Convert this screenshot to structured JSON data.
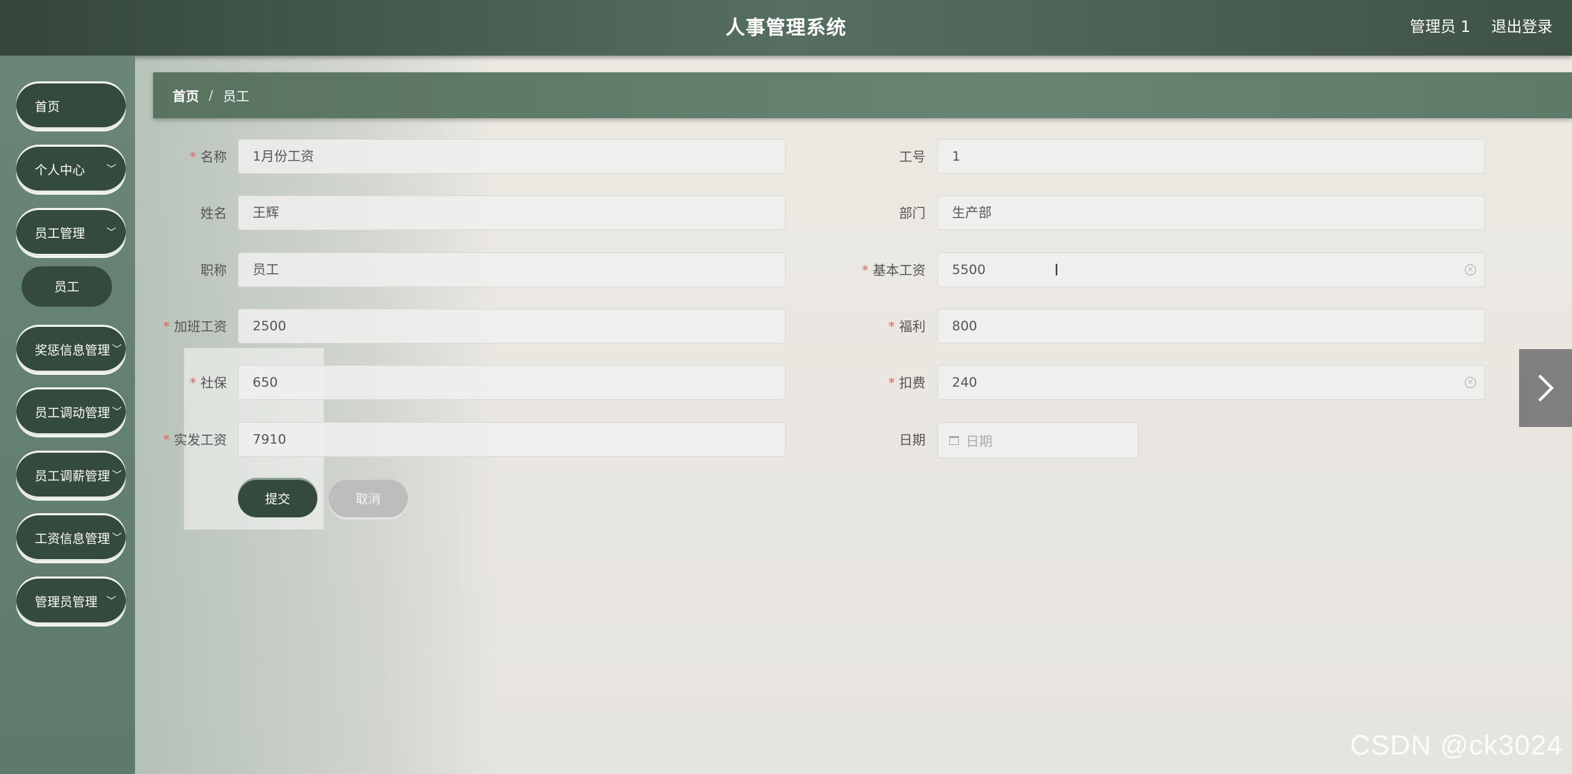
{
  "header": {
    "title": "人事管理系统",
    "user": "管理员 1",
    "logout": "退出登录"
  },
  "sidebar": {
    "items": [
      {
        "label": "首页"
      },
      {
        "label": "个人中心"
      },
      {
        "label": "员工管理"
      },
      {
        "label": "员工"
      },
      {
        "label": "奖惩信息管理"
      },
      {
        "label": "员工调动管理"
      },
      {
        "label": "员工调薪管理"
      },
      {
        "label": "工资信息管理"
      },
      {
        "label": "管理员管理"
      }
    ]
  },
  "breadcrumb": {
    "home": "首页",
    "sep": "/",
    "current": "员工"
  },
  "form": {
    "name": {
      "label": "名称",
      "value": "1月份工资"
    },
    "job_no": {
      "label": "工号",
      "value": "1"
    },
    "full_name": {
      "label": "姓名",
      "value": "王辉"
    },
    "department": {
      "label": "部门",
      "value": "生产部"
    },
    "title": {
      "label": "职称",
      "value": "员工"
    },
    "base_salary": {
      "label": "基本工资",
      "value": "5500"
    },
    "overtime": {
      "label": "加班工资",
      "value": "2500"
    },
    "welfare": {
      "label": "福利",
      "value": "800"
    },
    "social": {
      "label": "社保",
      "value": "650"
    },
    "deduction": {
      "label": "扣费",
      "value": "240"
    },
    "actual": {
      "label": "实发工资",
      "value": "7910"
    },
    "date": {
      "label": "日期",
      "placeholder": "日期"
    },
    "submit": "提交",
    "cancel": "取消"
  },
  "watermark": "CSDN @ck3024"
}
